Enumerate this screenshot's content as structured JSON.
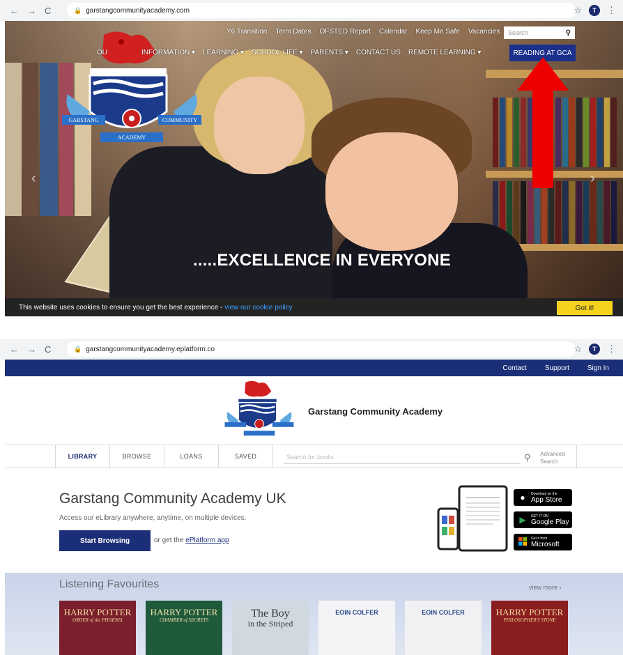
{
  "browser1": {
    "url": "garstangcommunityacademy.com",
    "nav_icons": [
      "back-arrow-icon",
      "forward-arrow-icon",
      "reload-icon"
    ]
  },
  "site1": {
    "utility_links": [
      "Y6 Transition",
      "Term Dates",
      "OFSTED Report",
      "Calendar",
      "Keep Me Safe",
      "Vacancies"
    ],
    "search_placeholder": "Search",
    "main_nav": [
      "OU",
      "INFORMATION ▾",
      "LEARNING ▾",
      "SCHOOL LIFE ▾",
      "PARENTS ▾",
      "CONTACT US",
      "REMOTE LEARNING ▾"
    ],
    "reading_button": "READING AT GCA",
    "crest_left": "GARSTANG",
    "crest_right": "COMMUNITY",
    "crest_bottom": "ACADEMY",
    "hero_text": ".....EXCELLENCE IN EVERYONE",
    "cookie_text": "This website uses cookies to ensure you get the best experience -",
    "cookie_link": "view our cookie policy",
    "cookie_button": "Got it!"
  },
  "browser2": {
    "url": "garstangcommunityacademy.eplatform.co",
    "avatar_initial": "T"
  },
  "site2": {
    "top_links": [
      "Contact",
      "Support",
      "Sign In"
    ],
    "school_name": "Garstang Community Academy",
    "tabs": [
      "LIBRARY",
      "BROWSE",
      "LOANS",
      "SAVED"
    ],
    "search_placeholder": "Search for books",
    "advanced_line1": "Advanced",
    "advanced_line2": "Search",
    "library_title": "Garstang Community Academy UK",
    "library_subtitle": "Access our eLibrary anywhere, anytime, on multiple devices.",
    "start_button": "Start Browsing",
    "or_get": "or get the",
    "app_link": "ePlatform app",
    "stores": [
      {
        "small": "Download on the",
        "big": "App Store",
        "icon": "apple-icon"
      },
      {
        "small": "GET IT ON",
        "big": "Google Play",
        "icon": "google-play-icon"
      },
      {
        "small": "Get it from",
        "big": "Microsoft",
        "icon": "microsoft-icon"
      }
    ],
    "section_title": "Listening Favourites",
    "view_more": "view more ›",
    "books": [
      {
        "title": "HARRY POTTER",
        "sub": "ORDER of the PHOENIX",
        "bg": "#7a1f2b",
        "fg": "#f3d9a0"
      },
      {
        "title": "HARRY POTTER",
        "sub": "CHAMBER of SECRETS",
        "bg": "#1f5a3a",
        "fg": "#f3e2b0"
      },
      {
        "title": "The Boy",
        "sub": "in the Striped",
        "bg": "#cfd9df",
        "fg": "#3a3a3a"
      },
      {
        "title": "EOIN COLFER",
        "sub": "",
        "bg": "#f4f4f6",
        "fg": "#2a4a8a"
      },
      {
        "title": "EOIN COLFER",
        "sub": "",
        "bg": "#f1f1f3",
        "fg": "#2a4a8a"
      },
      {
        "title": "HARRY POTTER",
        "sub": "PHILOSOPHER'S STONE",
        "bg": "#8a1e1e",
        "fg": "#f3d9a0"
      }
    ]
  },
  "colors": {
    "navy": "#1b2e78",
    "reading_btn": "#1b2f8c",
    "arrow_red": "#ee0000",
    "cookie_yellow": "#f4d21e"
  }
}
